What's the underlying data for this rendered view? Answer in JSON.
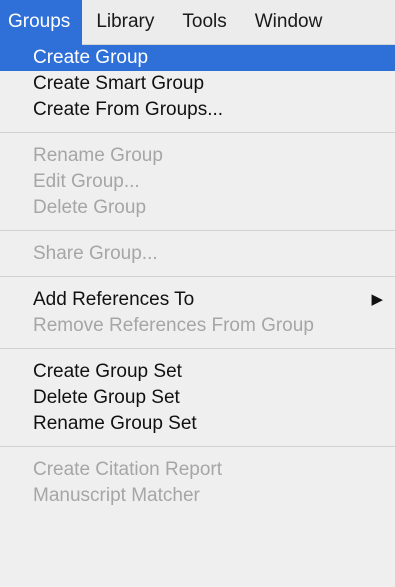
{
  "menubar": {
    "items": [
      "Groups",
      "Library",
      "Tools",
      "Window"
    ]
  },
  "menu": {
    "group1": [
      "Create Group",
      "Create Smart Group",
      "Create From Groups..."
    ],
    "group2": [
      "Rename Group",
      "Edit Group...",
      "Delete Group"
    ],
    "group3": [
      "Share Group..."
    ],
    "group4": [
      "Add References To",
      "Remove References From Group"
    ],
    "group5": [
      "Create Group Set",
      "Delete Group Set",
      "Rename Group Set"
    ],
    "group6": [
      "Create Citation Report",
      "Manuscript Matcher"
    ],
    "submenu_arrow": "▶"
  },
  "colors": {
    "highlight": "#2f6fd8",
    "disabled_text": "#a6a6a6",
    "menu_background": "#efefef"
  }
}
